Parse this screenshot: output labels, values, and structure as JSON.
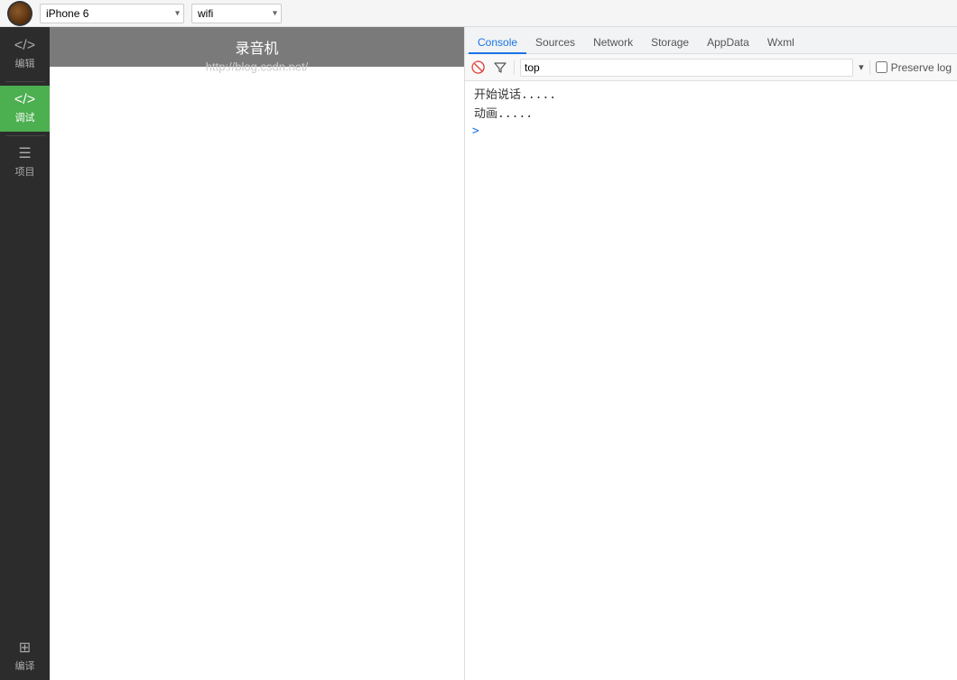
{
  "toolbar": {
    "device_label": "iPhone 6",
    "wifi_label": "wifi",
    "device_arrow": "▾",
    "wifi_arrow": "▾"
  },
  "sidebar": {
    "items": [
      {
        "id": "editor",
        "icon": "</>",
        "label": "编辑",
        "active": false
      },
      {
        "id": "debug",
        "icon": "</>",
        "label": "调试",
        "active": true
      },
      {
        "id": "project",
        "icon": "☰",
        "label": "项目",
        "active": false
      },
      {
        "id": "compile",
        "icon": "⊞",
        "label": "编译",
        "active": false
      }
    ]
  },
  "phone": {
    "title": "录音机",
    "watermark": "http://blog.csdn.net/"
  },
  "devtools": {
    "tabs": [
      {
        "id": "console",
        "label": "Console",
        "active": true
      },
      {
        "id": "sources",
        "label": "Sources",
        "active": false
      },
      {
        "id": "network",
        "label": "Network",
        "active": false
      },
      {
        "id": "storage",
        "label": "Storage",
        "active": false
      },
      {
        "id": "appdata",
        "label": "AppData",
        "active": false
      },
      {
        "id": "wxml",
        "label": "Wxml",
        "active": false
      }
    ],
    "toolbar": {
      "no_icon": "🚫",
      "filter_icon": "▽",
      "filter_value": "top",
      "filter_arrow": "▾",
      "preserve_log": "Preserve log"
    },
    "console_lines": [
      {
        "text": "开始说话.....",
        "type": "log"
      },
      {
        "text": "动画.....",
        "type": "log"
      }
    ]
  }
}
